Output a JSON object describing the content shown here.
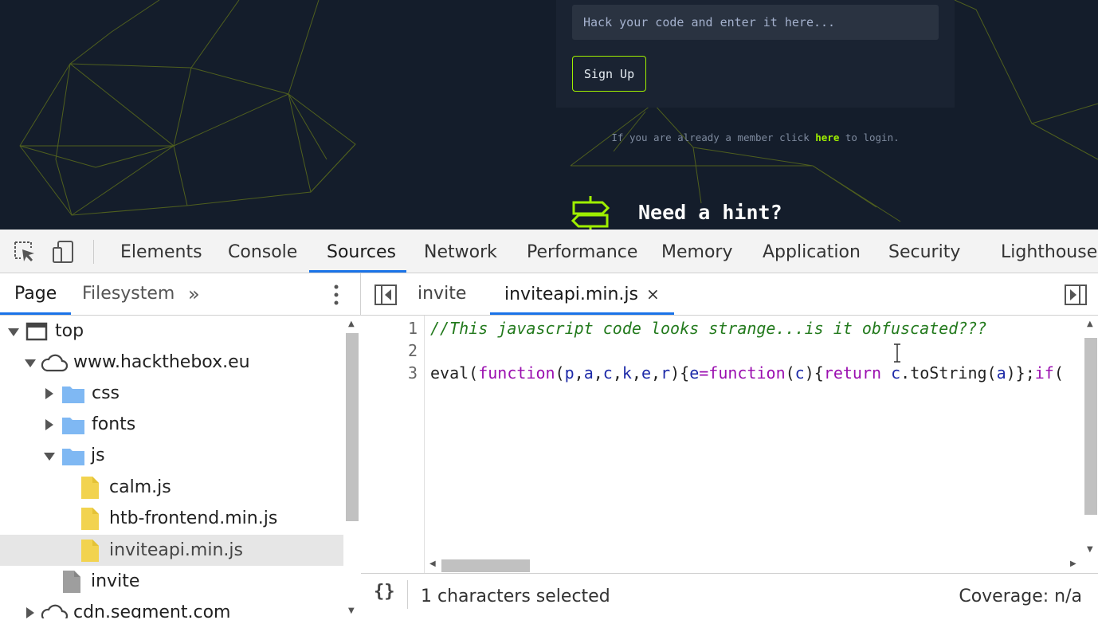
{
  "page": {
    "code_placeholder": "Hack your code and enter it here...",
    "signup_label": "Sign Up",
    "member_prefix": "If you are already a member click ",
    "member_link": "here",
    "member_suffix": " to login.",
    "hint_title": "Need a hint?"
  },
  "devtools": {
    "main_tabs": [
      {
        "label": "Elements"
      },
      {
        "label": "Console"
      },
      {
        "label": "Sources",
        "active": true
      },
      {
        "label": "Network"
      },
      {
        "label": "Performance"
      },
      {
        "label": "Memory"
      },
      {
        "label": "Application"
      },
      {
        "label": "Security"
      },
      {
        "label": "Lighthouse"
      }
    ],
    "icons": {
      "inspect": "inspect-element-icon",
      "device": "device-toolbar-icon",
      "more_tabs": "double-chevron-icon",
      "kebab": "vertical-dots-icon",
      "folder": "folder-icon",
      "file": "file-icon",
      "cloud": "cloud-icon",
      "frame": "frame-icon"
    },
    "navigator": {
      "tabs": [
        {
          "label": "Page",
          "active": true
        },
        {
          "label": "Filesystem"
        }
      ],
      "more": "»",
      "tree": [
        {
          "label": "top"
        },
        {
          "label": "www.hackthebox.eu"
        },
        {
          "label": "css"
        },
        {
          "label": "fonts"
        },
        {
          "label": "js"
        },
        {
          "label": "calm.js"
        },
        {
          "label": "htb-frontend.min.js"
        },
        {
          "label": "inviteapi.min.js",
          "selected": true
        },
        {
          "label": "invite"
        },
        {
          "label": "cdn.segment.com"
        }
      ]
    },
    "editor": {
      "tabs": [
        {
          "label": "invite"
        },
        {
          "label": "inviteapi.min.js",
          "active": true
        }
      ],
      "close": "×",
      "line_numbers": [
        "1",
        "2",
        "3"
      ],
      "code": {
        "line1": "//This javascript code looks strange...is it obfuscated???",
        "line3": [
          "eval(",
          "function",
          "(",
          "p",
          ",",
          "a",
          ",",
          "c",
          ",",
          "k",
          ",",
          "e",
          ",",
          "r",
          "){",
          "e",
          "=",
          "function",
          "(",
          "c",
          "){",
          "return",
          " ",
          "c",
          ".toString(",
          "a",
          ")};",
          "if",
          "("
        ]
      },
      "pretty_print": "{}",
      "status_selection": "1 characters selected",
      "status_coverage": "Coverage: n/a"
    },
    "accent_color": "#1a73e8",
    "htb_green": "#9fef00"
  }
}
